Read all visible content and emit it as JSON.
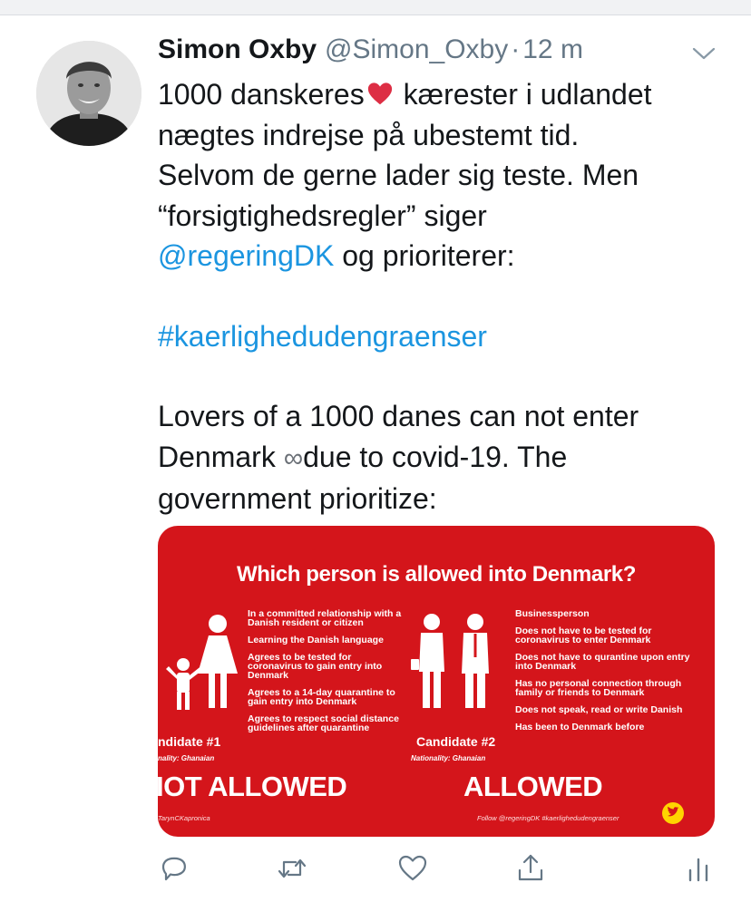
{
  "tweet": {
    "display_name": "Simon Oxby",
    "handle": "@Simon_Oxby",
    "separator": "·",
    "time": "12 m",
    "text": {
      "l1_a": "1000 danskeres",
      "l1_b": " kærester i udlandet",
      "l2": "nægtes indrejse på ubestemt tid.",
      "l3": "Selvom de gerne lader sig teste. Men",
      "l4": "“forsigtighedsregler” siger",
      "mention": "@regeringDK",
      "l5_rest": " og prioriterer:",
      "hashtag": "#kaerlighedudengraenser",
      "l6": "Lovers of a 1000 danes can not enter",
      "l7_a": "Denmark ",
      "infinity": "∞",
      "l7_b": "due to covid-19. The",
      "l8": "government prioritize:"
    }
  },
  "media": {
    "title": "Which person is allowed into Denmark?",
    "left_items": [
      "In a committed relationship with a Danish resident or citizen",
      "Learning the Danish language",
      "Agrees to be tested for coronavirus to gain entry into Denmark",
      "Agrees to a 14-day quarantine to gain entry into Denmark",
      "Agrees to respect social distance guidelines after quarantine"
    ],
    "right_items": [
      "Businessperson",
      "Does not have to be tested for coronavirus to enter Denmark",
      "Does not have to qurantine upon entry into Denmark",
      "Has no personal connection through family or friends to Denmark",
      "Does not speak, read or write Danish",
      "Has been to Denmark before"
    ],
    "candidate1": "ndidate #1",
    "nationality1": "nality: Ghanaian",
    "candidate2": "Candidate #2",
    "nationality2": "Nationality: Ghanaian",
    "verdict_left": "IOT ALLOWED",
    "verdict_right": "ALLOWED",
    "credit_left": "TarynCKapronica",
    "credit_right": "Follow @regeringDK #kaerlighedudengraenser"
  },
  "colors": {
    "link": "#1b95e0",
    "media_red": "#d4151b",
    "icon_gray": "#657786"
  },
  "icons": [
    "chevron-down-icon",
    "heart-emoji-icon",
    "reply-icon",
    "retweet-icon",
    "like-icon",
    "share-icon",
    "analytics-icon",
    "twitter-bird-icon"
  ]
}
